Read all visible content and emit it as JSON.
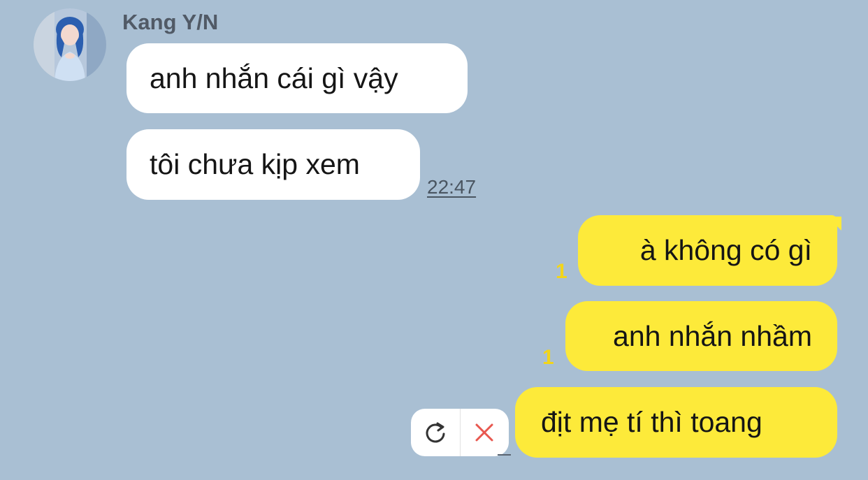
{
  "chat": {
    "sender_name": "Kang Y/N",
    "incoming": [
      {
        "text": "anh nhắn cái gì vậy"
      },
      {
        "text": "tôi chưa kịp xem"
      }
    ],
    "incoming_time": "22:47",
    "outgoing": [
      {
        "text": "à không có gì",
        "unread": "1"
      },
      {
        "text": "anh nhắn nhầm",
        "unread": "1"
      },
      {
        "text": "địt mẹ tí thì toang"
      }
    ]
  },
  "icons": {
    "retry": "refresh-icon",
    "delete": "close-icon"
  },
  "colors": {
    "background": "#a9bfd3",
    "incoming_bubble": "#ffffff",
    "outgoing_bubble": "#fdea3a",
    "unread_count": "#f2d51a",
    "delete_icon": "#e8574f"
  }
}
